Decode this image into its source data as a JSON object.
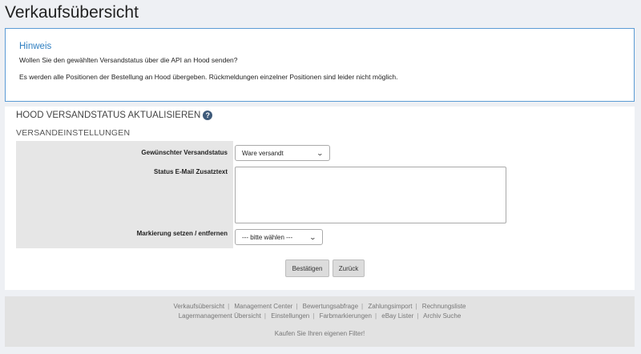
{
  "page": {
    "title": "Verkaufsübersicht"
  },
  "notice": {
    "title": "Hinweis",
    "line1": "Wollen Sie den gewählten Versandstatus über die API an Hood senden?",
    "line2": "Es werden alle Positionen der Bestellung an Hood übergeben. Rückmeldungen einzelner Positionen sind leider nicht möglich."
  },
  "section": {
    "title": "HOOD VERSANDSTATUS AKTUALISIEREN",
    "help_icon": "?",
    "subtitle": "VERSANDEINSTELLUNGEN"
  },
  "form": {
    "shipping_status_label": "Gewünschter Versandstatus",
    "shipping_status_value": "Ware versandt",
    "email_text_label": "Status E-Mail Zusatztext",
    "email_text_value": "",
    "marker_label": "Markierung setzen / entfernen",
    "marker_value": "--- bitte wählen ---"
  },
  "buttons": {
    "confirm": "Bestätigen",
    "back": "Zurück"
  },
  "footer": {
    "row1": [
      "Verkaufsübersicht",
      "Management Center",
      "Bewertungsabfrage",
      "Zahlungsimport",
      "Rechnungsliste"
    ],
    "row2": [
      "Lagermanagement Übersicht",
      "Einstellungen",
      "Farbmarkierungen",
      "eBay Lister",
      "Archiv Suche"
    ],
    "tagline": "Kaufen Sie Ihren eigenen Filter!"
  },
  "colors": {
    "accent": "#2f7fc1",
    "notice_border": "#5b9bd5"
  }
}
